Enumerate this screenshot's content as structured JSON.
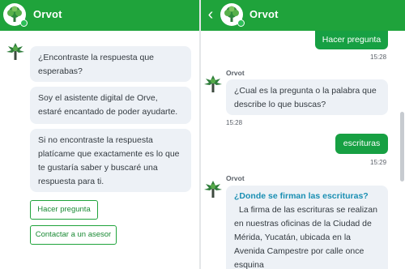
{
  "app": {
    "name": "Orvot",
    "brand_color": "#1fa33b",
    "bubble_color": "#edf1f6",
    "link_color": "#1a8fb3"
  },
  "left_panel": {
    "header": {
      "title": "Orvot",
      "avatar_icon": "tree-logo-icon"
    },
    "messages": [
      "¿Encontraste la respuesta que esperabas?",
      "Soy el asistente digital de Orve, estaré encantado de poder ayudarte.",
      "Si no encontraste la respuesta platícame que exactamente es lo que te gustaría saber y buscaré una respuesta para ti."
    ],
    "options": [
      "Hacer pregunta",
      "Contactar a un asesor"
    ]
  },
  "right_panel": {
    "header": {
      "title": "Orvot",
      "back_icon": "chevron-left-icon",
      "avatar_icon": "tree-logo-icon"
    },
    "user_msg_1": {
      "text": "Hacer pregunta",
      "time": "15:28"
    },
    "bot_msg_1": {
      "sender": "Orvot",
      "text": "¿Cual es la pregunta o la palabra que describe lo que buscas?",
      "time": "15:28"
    },
    "user_msg_2": {
      "text": "escrituras",
      "time": "15:29"
    },
    "bot_msg_2": {
      "sender": "Orvot",
      "title": "¿Donde se firman las escrituras?",
      "body": "La firma de las escrituras se realizan en nuestras oficinas de la Ciudad de Mérida, Yucatán, ubicada en la Avenida Campestre por calle once esquina"
    }
  }
}
